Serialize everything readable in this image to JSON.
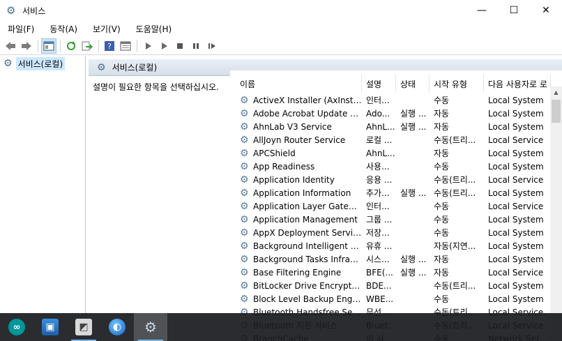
{
  "window": {
    "title": "서비스",
    "icon": "gear-icon"
  },
  "window_buttons": {
    "minimize": "—",
    "maximize": "☐",
    "close": "✕"
  },
  "menu": [
    "파일(F)",
    "동작(A)",
    "보기(V)",
    "도움말(H)"
  ],
  "toolbar": {
    "buttons": [
      "back-arrow-icon",
      "forward-arrow-icon",
      "console-tree-icon",
      "refresh-icon",
      "export-icon",
      "help-icon",
      "properties-icon",
      "start-icon",
      "start-alt-icon",
      "stop-icon",
      "pause-icon",
      "restart-icon"
    ]
  },
  "tree": {
    "item": "서비스(로컬)"
  },
  "pane": {
    "header": "서비스(로컬)",
    "description": "설명이 필요한 항목을 선택하십시오."
  },
  "table": {
    "columns": [
      "이름",
      "설명",
      "상태",
      "시작 유형",
      "다음 사용자로 로"
    ],
    "rows": [
      {
        "name": "ActiveX Installer (AxInstSV)",
        "desc": "인터...",
        "state": "",
        "start": "수동",
        "logon": "Local System"
      },
      {
        "name": "Adobe Acrobat Update Ser...",
        "desc": "Ado...",
        "state": "실행 ...",
        "start": "자동",
        "logon": "Local System"
      },
      {
        "name": "AhnLab V3 Service",
        "desc": "AhnL...",
        "state": "실행 ...",
        "start": "자동",
        "logon": "Local System"
      },
      {
        "name": "AllJoyn Router Service",
        "desc": "로컬 ...",
        "state": "",
        "start": "수동(트리...",
        "logon": "Local Service"
      },
      {
        "name": "APCShield",
        "desc": "AhnL...",
        "state": "",
        "start": "자동",
        "logon": "Local System"
      },
      {
        "name": "App Readiness",
        "desc": "사용...",
        "state": "",
        "start": "수동",
        "logon": "Local System"
      },
      {
        "name": "Application Identity",
        "desc": "응용 ...",
        "state": "",
        "start": "수동(트리...",
        "logon": "Local Service"
      },
      {
        "name": "Application Information",
        "desc": "추가...",
        "state": "실행 ...",
        "start": "수동(트리...",
        "logon": "Local System"
      },
      {
        "name": "Application Layer Gateway ...",
        "desc": "인터...",
        "state": "",
        "start": "수동",
        "logon": "Local Service"
      },
      {
        "name": "Application Management",
        "desc": "그룹 ...",
        "state": "",
        "start": "수동",
        "logon": "Local System"
      },
      {
        "name": "AppX Deployment Service ...",
        "desc": "저장...",
        "state": "",
        "start": "수동",
        "logon": "Local System"
      },
      {
        "name": "Background Intelligent Tra...",
        "desc": "유휴 ...",
        "state": "",
        "start": "자동(지연...",
        "logon": "Local System"
      },
      {
        "name": "Background Tasks Infrastru...",
        "desc": "시스...",
        "state": "실행 ...",
        "start": "자동",
        "logon": "Local System"
      },
      {
        "name": "Base Filtering Engine",
        "desc": "BFE(...",
        "state": "실행 ...",
        "start": "자동",
        "logon": "Local Service"
      },
      {
        "name": "BitLocker Drive Encryption ...",
        "desc": "BDE...",
        "state": "",
        "start": "수동(트리...",
        "logon": "Local System"
      },
      {
        "name": "Block Level Backup Engine ...",
        "desc": "WBE...",
        "state": "",
        "start": "수동",
        "logon": "Local System"
      },
      {
        "name": "Bluetooth Handsfree Service",
        "desc": "무선 ...",
        "state": "",
        "start": "수동(트리...",
        "logon": "Local Service"
      },
      {
        "name": "Bluetooth 지원 서비스",
        "desc": "Bluet...",
        "state": "",
        "start": "수동(트리...",
        "logon": "Local Service"
      },
      {
        "name": "BranchCache",
        "desc": "이 서...",
        "state": "",
        "start": "수동",
        "logon": "Network Service"
      }
    ]
  },
  "taskbar": {
    "items": [
      {
        "icon": "arduino-icon",
        "glyph": "∞"
      },
      {
        "icon": "computer-icon",
        "glyph": "▣"
      },
      {
        "icon": "resource-monitor-icon",
        "glyph": "◩"
      },
      {
        "icon": "google-earth-icon",
        "glyph": "◐"
      },
      {
        "icon": "services-gear-icon",
        "glyph": "⚙"
      }
    ]
  }
}
